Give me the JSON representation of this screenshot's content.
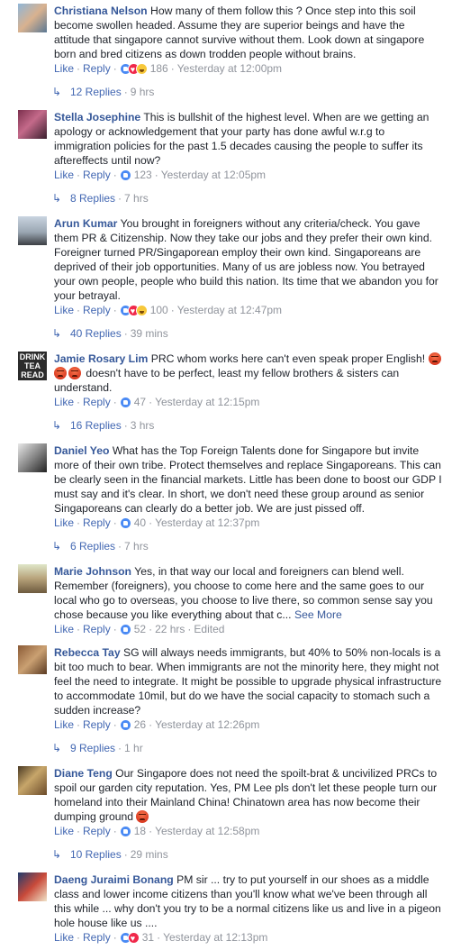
{
  "actions": {
    "like": "Like",
    "reply": "Reply",
    "sep": "·"
  },
  "comments": [
    {
      "name": "Christiana Nelson",
      "text": "How many of them follow this ? Once step into this soil become swollen headed. Assume they are superior beings and have the attitude that singapore cannot survive without them. Look down at singapore born and bred citizens as down trodden people without brains.",
      "reactions": [
        "like",
        "love",
        "haha"
      ],
      "reaction_count": "186",
      "time": "Yesterday at 12:00pm",
      "replies": "12 Replies",
      "replies_time": "9 hrs"
    },
    {
      "name": "Stella Josephine",
      "text": "This is bullshit of the highest level. When are we getting an apology or acknowledgement that your party has done awful w.r.g to immigration policies for the past 1.5 decades causing the people to suffer its aftereffects until now?",
      "reactions": [
        "like"
      ],
      "reaction_count": "123",
      "time": "Yesterday at 12:05pm",
      "replies": "8 Replies",
      "replies_time": "7 hrs"
    },
    {
      "name": "Arun Kumar",
      "text": "You brought in foreigners without any criteria/check. You gave them PR & Citizenship. Now they take our jobs and they prefer their own kind. Foreigner turned PR/Singaporean employ their own kind. Singaporeans are deprived of their job opportunities. Many of us are jobless now. You betrayed your own people, people who build this nation. Its time that we abandon you for your betrayal.",
      "reactions": [
        "like",
        "love",
        "haha"
      ],
      "reaction_count": "100",
      "time": "Yesterday at 12:47pm",
      "replies": "40 Replies",
      "replies_time": "39 mins"
    },
    {
      "name": "Jamie Rosary Lim",
      "text": "PRC whom works here can't even speak proper English!",
      "emoji_count": 3,
      "text_after": "doesn't have to be perfect, least my fellow brothers & sisters can understand.",
      "avatar_text": "DRINK TEA READ",
      "reactions": [
        "like"
      ],
      "reaction_count": "47",
      "time": "Yesterday at 12:15pm",
      "replies": "16 Replies",
      "replies_time": "3 hrs"
    },
    {
      "name": "Daniel Yeo",
      "text": "What has the Top Foreign Talents done for Singapore but invite more of their own tribe. Protect themselves and replace Singaporeans. This can be clearly seen in the financial markets. Little has been done to boost our GDP I must say and it's clear. In short, we don't need these group around as senior Singaporeans can clearly do a better job. We are just pissed off.",
      "reactions": [
        "like"
      ],
      "reaction_count": "40",
      "time": "Yesterday at 12:37pm",
      "replies": "6 Replies",
      "replies_time": "7 hrs"
    },
    {
      "name": "Marie Johnson",
      "text": "Yes, in that way our local and foreigners can blend well. Remember (foreigners), you choose to come here and the same goes to our local who go to overseas, you choose to live there, so common sense say you chose because you like everything about that c...",
      "see_more": "See More",
      "reactions": [
        "like"
      ],
      "reaction_count": "52",
      "time": "22 hrs",
      "edited": "Edited"
    },
    {
      "name": "Rebecca Tay",
      "text": "SG will always needs immigrants, but 40% to 50% non-locals is a bit too much to bear. When immigrants are not the minority here, they might not feel the need to integrate. It might be possible to upgrade physical infrastructure to accommodate 10mil, but do we have the social capacity to stomach such a sudden increase?",
      "reactions": [
        "like"
      ],
      "reaction_count": "26",
      "time": "Yesterday at 12:26pm",
      "replies": "9 Replies",
      "replies_time": "1 hr"
    },
    {
      "name": "Diane Teng",
      "text": "Our Singapore does not need the spoilt-brat & uncivilized PRCs to spoil our garden city reputation. Yes, PM Lee pls don't let these people turn our homeland into their Mainland China! Chinatown area has now become their dumping ground",
      "emoji_count": 1,
      "reactions": [
        "like"
      ],
      "reaction_count": "18",
      "time": "Yesterday at 12:58pm",
      "replies": "10 Replies",
      "replies_time": "29 mins"
    },
    {
      "name": "Daeng Juraimi Bonang",
      "text": "PM sir ... try to put yourself in our shoes as a middle class and lower income citizens than you'll know what we've been through all this while ... why don't you try to be a normal citizens like us and live in a pigeon hole house like us ....",
      "reactions": [
        "like",
        "love"
      ],
      "reaction_count": "31",
      "time": "Yesterday at 12:13pm"
    }
  ]
}
